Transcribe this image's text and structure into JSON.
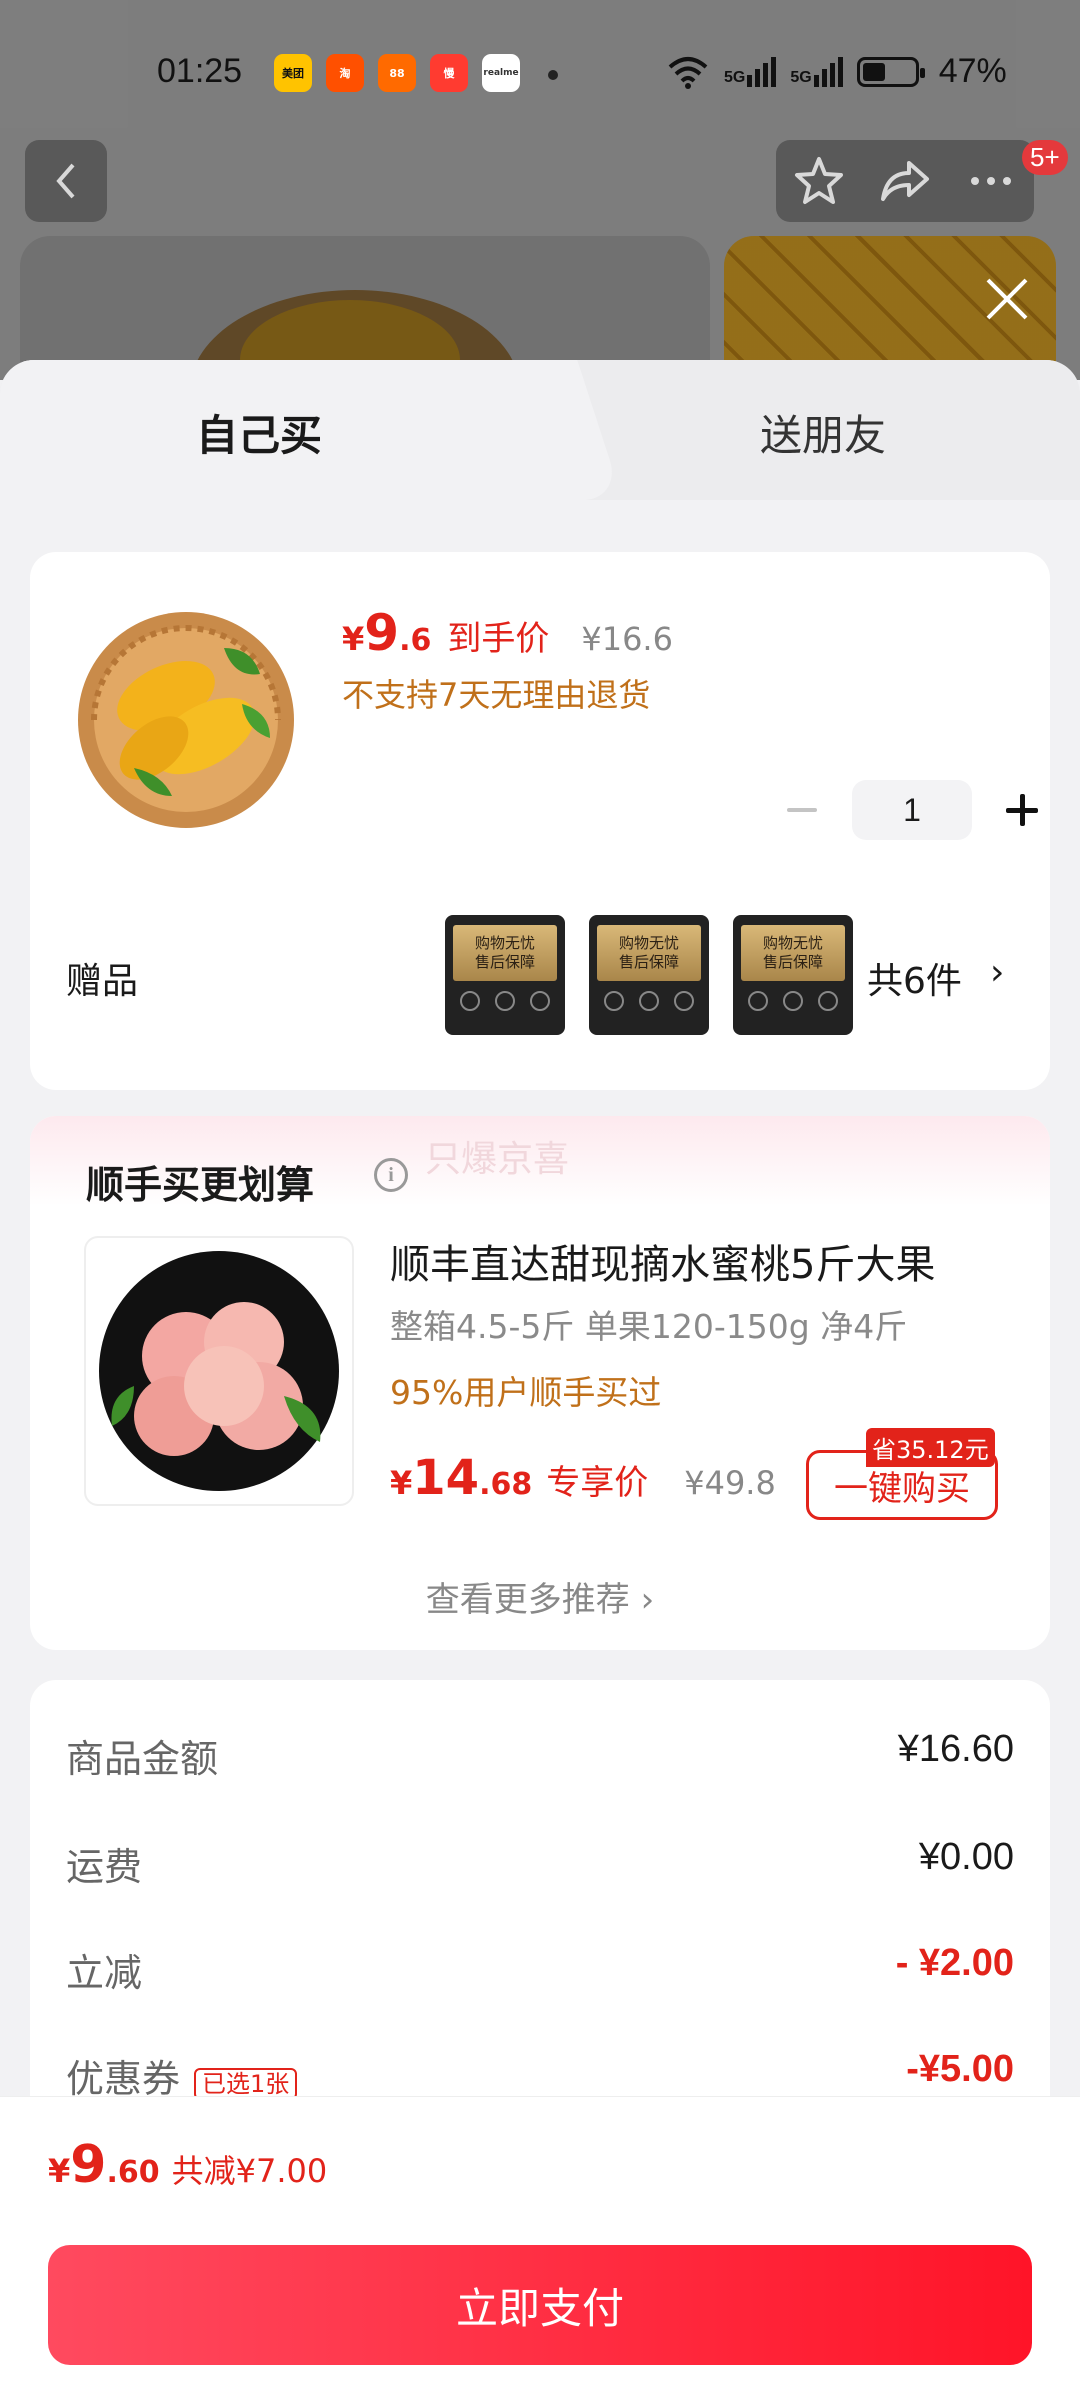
{
  "status_bar": {
    "time": "01:25",
    "apps": [
      {
        "name": "meituan-icon",
        "label": "美团",
        "color": "#ffc300"
      },
      {
        "name": "taobao-icon",
        "label": "淘",
        "color": "#ff5000"
      },
      {
        "name": "app-icon",
        "label": "88",
        "color": "#ff6a00"
      },
      {
        "name": "man-icon",
        "label": "慢",
        "color": "#ff3b30"
      },
      {
        "name": "realme-icon",
        "label": "realme",
        "color": "#ffffff"
      }
    ],
    "signal1": "5G",
    "signal2": "5G",
    "battery": "47%"
  },
  "nav": {
    "badge": "5+"
  },
  "tabs": {
    "self": "自己买",
    "gift": "送朋友"
  },
  "product": {
    "currency": "¥",
    "price_int": "9",
    "price_dec": ".6",
    "price_label": "到手价",
    "orig_price": "¥16.6",
    "notice": "不支持7天无理由退货",
    "quantity": "1"
  },
  "gifts": {
    "label": "赠品",
    "card_line1": "购物无忧",
    "card_line2": "售后保障",
    "count": "共6件",
    "chevron": "›"
  },
  "recommend": {
    "watermark": "只爆京喜",
    "title": "顺手买更划算",
    "name": "顺丰直达甜现摘水蜜桃5斤大果",
    "spec": "整箱4.5-5斤 单果120-150g 净4斤",
    "stat": "95%用户顺手买过",
    "currency": "¥",
    "price_int": "14",
    "price_dec": ".68",
    "price_label": "专享价",
    "orig_price": "¥49.8",
    "save_tag": "省35.12元",
    "buy_label": "一键购买",
    "more": "查看更多推荐 ›"
  },
  "summary": {
    "rows": [
      {
        "label": "商品金额",
        "value": "¥16.60"
      },
      {
        "label": "运费",
        "value": "¥0.00"
      },
      {
        "label": "立减",
        "value": "- ¥2.00"
      },
      {
        "label": "优惠券",
        "tag": "已选1张",
        "value": "-¥5.00"
      }
    ]
  },
  "footer": {
    "currency": "¥",
    "total_int": "9",
    "total_dec": ".60",
    "discount": "共减¥7.00",
    "pay_label": "立即支付"
  },
  "colors": {
    "accent_red": "#e2231a",
    "orange_text": "#c0701a",
    "pay_gradient_start": "#ff4a5f",
    "pay_gradient_end": "#ff1428"
  }
}
